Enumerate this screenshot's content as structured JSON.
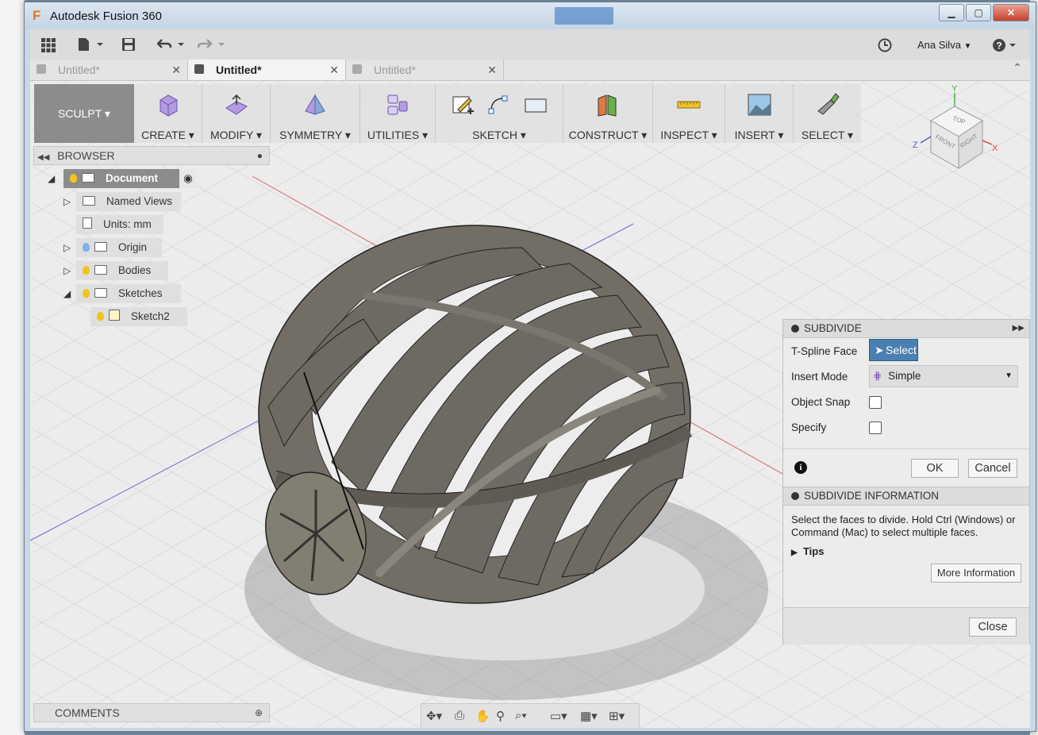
{
  "window": {
    "title": "Autodesk Fusion 360",
    "logo": "F",
    "min": "▁",
    "max": "▢",
    "close": "✕"
  },
  "menubar": {
    "user": "Ana Silva",
    "user_caret": "▼",
    "help_icon": "?"
  },
  "tabs": [
    {
      "label": "Untitled*",
      "active": false
    },
    {
      "label": "Untitled*",
      "active": true
    },
    {
      "label": "Untitled*",
      "active": false
    }
  ],
  "toolbar": {
    "workspace": "SCULPT ▾",
    "groups": [
      {
        "label": "CREATE ▾"
      },
      {
        "label": "MODIFY ▾"
      },
      {
        "label": "SYMMETRY ▾"
      },
      {
        "label": "UTILITIES ▾"
      },
      {
        "label": "SKETCH ▾"
      },
      {
        "label": "CONSTRUCT ▾"
      },
      {
        "label": "INSPECT ▾"
      },
      {
        "label": "INSERT ▾"
      },
      {
        "label": "SELECT ▾"
      }
    ]
  },
  "browser": {
    "title": "BROWSER",
    "items": {
      "document": "Document",
      "named_views": "Named Views",
      "units": "Units: mm",
      "origin": "Origin",
      "bodies": "Bodies",
      "sketches": "Sketches",
      "sketch2": "Sketch2"
    }
  },
  "comments": {
    "title": "COMMENTS"
  },
  "viewcube": {
    "top": "TOP",
    "front": "FRONT",
    "right": "RIGHT",
    "x": "X",
    "y": "Y",
    "z": "Z"
  },
  "subdivide": {
    "title": "SUBDIVIDE",
    "tspline_label": "T-Spline Face",
    "select_btn": "Select",
    "insert_mode_label": "Insert Mode",
    "insert_mode_value": "Simple",
    "object_snap_label": "Object Snap",
    "specify_label": "Specify",
    "ok": "OK",
    "cancel": "Cancel",
    "info_title": "SUBDIVIDE INFORMATION",
    "info_text_1": "Select the faces to divide. Hold Ctrl (Windows) or",
    "info_text_2": "Command (Mac) to select multiple faces.",
    "tips": "Tips",
    "more_info": "More Information",
    "close": "Close"
  },
  "colors": {
    "select_blue": "#4a7fb0",
    "workspace_gray": "#8c8c8c",
    "model_gray": "#6d6a63",
    "bulb_yellow": "#f0c420"
  }
}
